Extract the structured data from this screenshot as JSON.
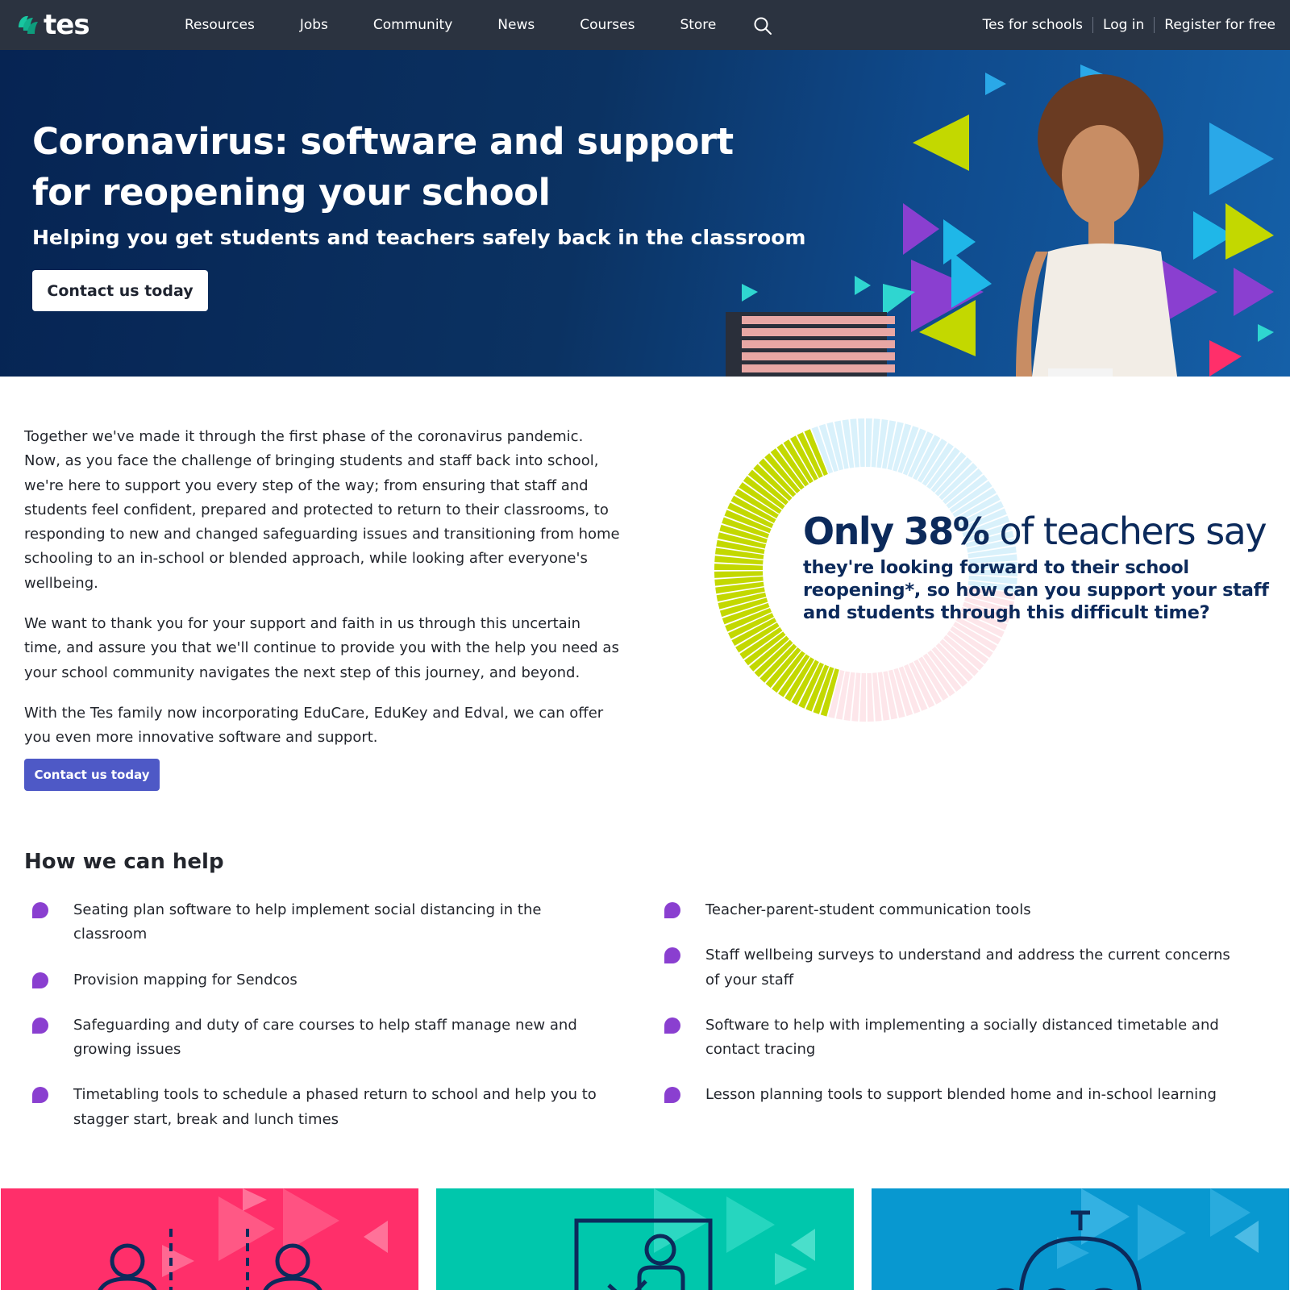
{
  "brand": {
    "name": "tes",
    "colors": {
      "nav": "#2b3340",
      "hero": "#0b3262",
      "accent_purple": "#8a3fd0",
      "cta_blue": "#4e59c6",
      "lime": "#c3d800",
      "navy_text": "#0c2a5b"
    }
  },
  "nav": {
    "links": [
      "Resources",
      "Jobs",
      "Community",
      "News",
      "Courses",
      "Store"
    ],
    "search_icon": "search-icon",
    "right": {
      "schools": "Tes for schools",
      "login": "Log in",
      "register": "Register for free"
    }
  },
  "hero": {
    "title": "Coronavirus: software and support for reopening your school",
    "subtitle": "Helping you get students and teachers safely back in the classroom",
    "cta": "Contact us today"
  },
  "intro": {
    "paragraphs": [
      "Together we've made it through the first phase of the coronavirus pandemic. Now, as you face the challenge of bringing students and staff back into school, we're here to support you every step of the way; from ensuring that staff and students feel confident, prepared and protected to return to their classrooms, to responding to new and changed safeguarding issues and transitioning from home schooling to an in-school or blended approach, while looking after everyone's wellbeing.",
      "We want to thank you for your support and faith in us through this uncertain time, and assure you that we'll continue to provide you with the help you need as your school community navigates the next step of this journey, and beyond.",
      "With the Tes family now incorporating EduCare, EduKey and Edval, we can offer you even more innovative software and support."
    ],
    "cta": "Contact us today"
  },
  "stat": {
    "only": "Only",
    "percent": "38%",
    "rest": "of teachers say",
    "detail": "they're looking forward to their school reopening*, so how can you support your staff and students through this difficult time?",
    "share": 0.38
  },
  "help": {
    "title": "How we can help",
    "left": [
      "Seating plan software to help implement social distancing in the classroom",
      "Provision mapping for Sendcos",
      "Safeguarding and duty of care courses to help staff manage new and growing issues",
      "Timetabling tools to schedule a phased return to school and help you to stagger start, break and lunch times"
    ],
    "right": [
      "Teacher-parent-student communication tools",
      "Staff wellbeing surveys to understand and address the current concerns of your staff",
      "Software to help with implementing a socially distanced timetable and contact tracing",
      "Lesson planning tools to support blended home and in-school learning"
    ]
  },
  "cards": [
    {
      "icon": "social-distancing-icon",
      "color": "#ff2f6a"
    },
    {
      "icon": "classroom-teacher-icon",
      "color": "#00c7ac"
    },
    {
      "icon": "timer-icon",
      "color": "#0898d0"
    }
  ]
}
